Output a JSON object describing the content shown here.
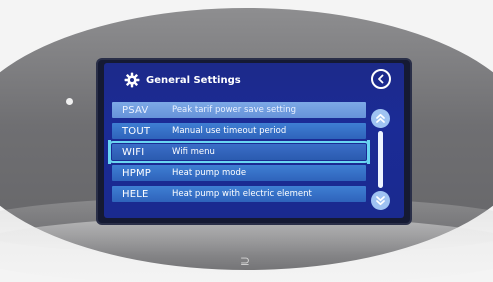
{
  "screen": {
    "title": "General Settings",
    "title_icon": "gear-icon",
    "back_icon": "back-chevron-icon"
  },
  "menu": {
    "items": [
      {
        "code": "PSAV",
        "description": "Peak tarif power save setting",
        "state": "dimmed"
      },
      {
        "code": "TOUT",
        "description": "Manual use timeout period",
        "state": "normal"
      },
      {
        "code": "WIFI",
        "description": "Wifi menu",
        "state": "selected"
      },
      {
        "code": "HPMP",
        "description": "Heat pump mode",
        "state": "normal"
      },
      {
        "code": "HELE",
        "description": "Heat pump with electric element",
        "state": "normal"
      }
    ]
  },
  "scrollbar": {
    "up_icon": "double-chevron-up-icon",
    "down_icon": "double-chevron-down-icon",
    "position_fraction": 0.0,
    "visible_fraction": 1.0
  },
  "colors": {
    "screen_bg": "#1b2b96",
    "row_bg": "#3f7fd3",
    "row_dim_bg": "#7da9e6",
    "selection_outline": "#6ad6f2",
    "text": "#ffffff"
  }
}
